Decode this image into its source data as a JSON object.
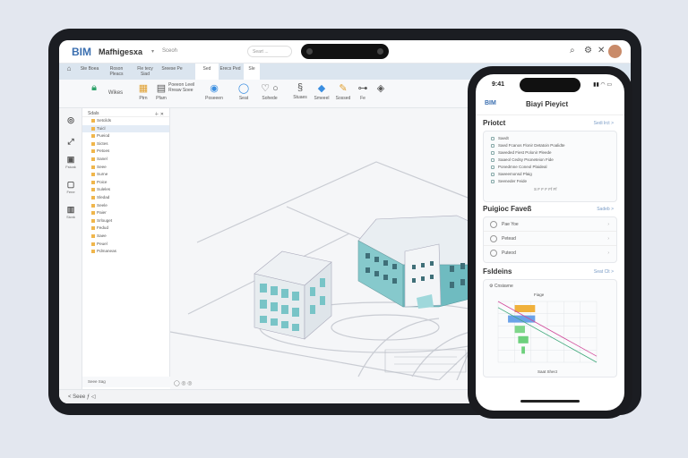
{
  "app": {
    "logo": "BIM",
    "name": "Mafhigesxa",
    "caret": "▾",
    "menu": "Sceoh",
    "search_placeholder": "Seart ..."
  },
  "topbar_icons": [
    "search-icon",
    "settings-icon",
    "close-icon"
  ],
  "tabs": [
    {
      "label": "Ste\nBoea"
    },
    {
      "label": "Roson\nPleacs"
    },
    {
      "label": "Fle tecy\nSiad"
    },
    {
      "label": "Sreese\nPe"
    },
    {
      "label": "Sed"
    },
    {
      "label": "Erecs\nPed"
    },
    {
      "label": "Sle"
    }
  ],
  "ribbon": [
    {
      "label": "Wikes"
    },
    {
      "label": "Ptrn"
    },
    {
      "label": "Pfam"
    },
    {
      "label": "Poeeon\nLeeil\nRreaw Soee"
    },
    {
      "label": "Poseeen"
    },
    {
      "label": "Seat"
    },
    {
      "label": "Sohede"
    },
    {
      "label": "Stuaes"
    },
    {
      "label": "Smeeel"
    },
    {
      "label": "Sossed"
    },
    {
      "label": "Fe"
    }
  ],
  "left_icons": [
    {
      "label": ""
    },
    {
      "label": ""
    },
    {
      "label": "Fsicak"
    },
    {
      "label": "Fene"
    },
    {
      "label": "Sicnk"
    }
  ],
  "tree": {
    "header": "Sdals",
    "rows": [
      "Setcilds",
      "Tuicl",
      "Pueiod",
      "Sictes",
      "Petoes",
      "Sanel",
      "Seee",
      "Surne",
      "Poice",
      "Suleles",
      "Sledad",
      "Seele",
      "Paier",
      "Srlouget",
      "Fedud",
      "Saee",
      "Peuel",
      "Pdmaneas"
    ],
    "footer": "Seee Sag"
  },
  "viewport_footer": "◯  ◎  ◎",
  "bottombar": "< Seee  ƒ  ◁",
  "phone": {
    "time": "9:41",
    "status": "▮▮ ◠ ▭",
    "logo": "BIM",
    "title": "Biayi Pieyict",
    "projects": {
      "title": "Priotct",
      "link": "Sedi lrct >",
      "rows": [
        "Saedt",
        "Saed Fcanos Flonir Detatoin Poalidte",
        "Saeeded Fiest Polonir Pleede",
        "Saaeol Cedsy Psoneteion Fide",
        "Ponedmne Coneol Plaideal",
        "Saeeemonsd Plaig",
        "Seeneder Feide"
      ],
      "axis": "S  F  F  F  Ff  Ff"
    },
    "faults": {
      "title": "Puigioc Faveß",
      "link": "Sadeb >",
      "rows": [
        "Pae Yoe",
        "Petead",
        "Puteod"
      ]
    },
    "chart_section": {
      "title": "Fsldeins",
      "link": "Seat Clt >",
      "chart_label": "Cnsiavne",
      "bar_label": "Fiage",
      "x_label": "Saat Shect"
    }
  },
  "chart_data": {
    "type": "bar",
    "orientation": "horizontal",
    "title": "Cnsiavne",
    "series": [
      {
        "name": "",
        "color": "#f0b13c",
        "start": 4,
        "end": 10
      },
      {
        "name": "",
        "color": "#6aa2e8",
        "start": 2,
        "end": 10
      },
      {
        "name": "",
        "color": "#7fd68a",
        "start": 4,
        "end": 7
      },
      {
        "name": "",
        "color": "#6dd07c",
        "start": 5,
        "end": 8
      },
      {
        "name": "",
        "color": "#6dd07c",
        "start": 6,
        "end": 7
      }
    ],
    "lines": [
      {
        "color": "#d14a9a",
        "points": [
          [
            0,
            10
          ],
          [
            16,
            1
          ]
        ]
      },
      {
        "color": "#3ea87a",
        "points": [
          [
            0,
            9
          ],
          [
            16,
            0
          ]
        ]
      }
    ],
    "xlim": [
      0,
      16
    ],
    "ylim": [
      0,
      10
    ]
  }
}
